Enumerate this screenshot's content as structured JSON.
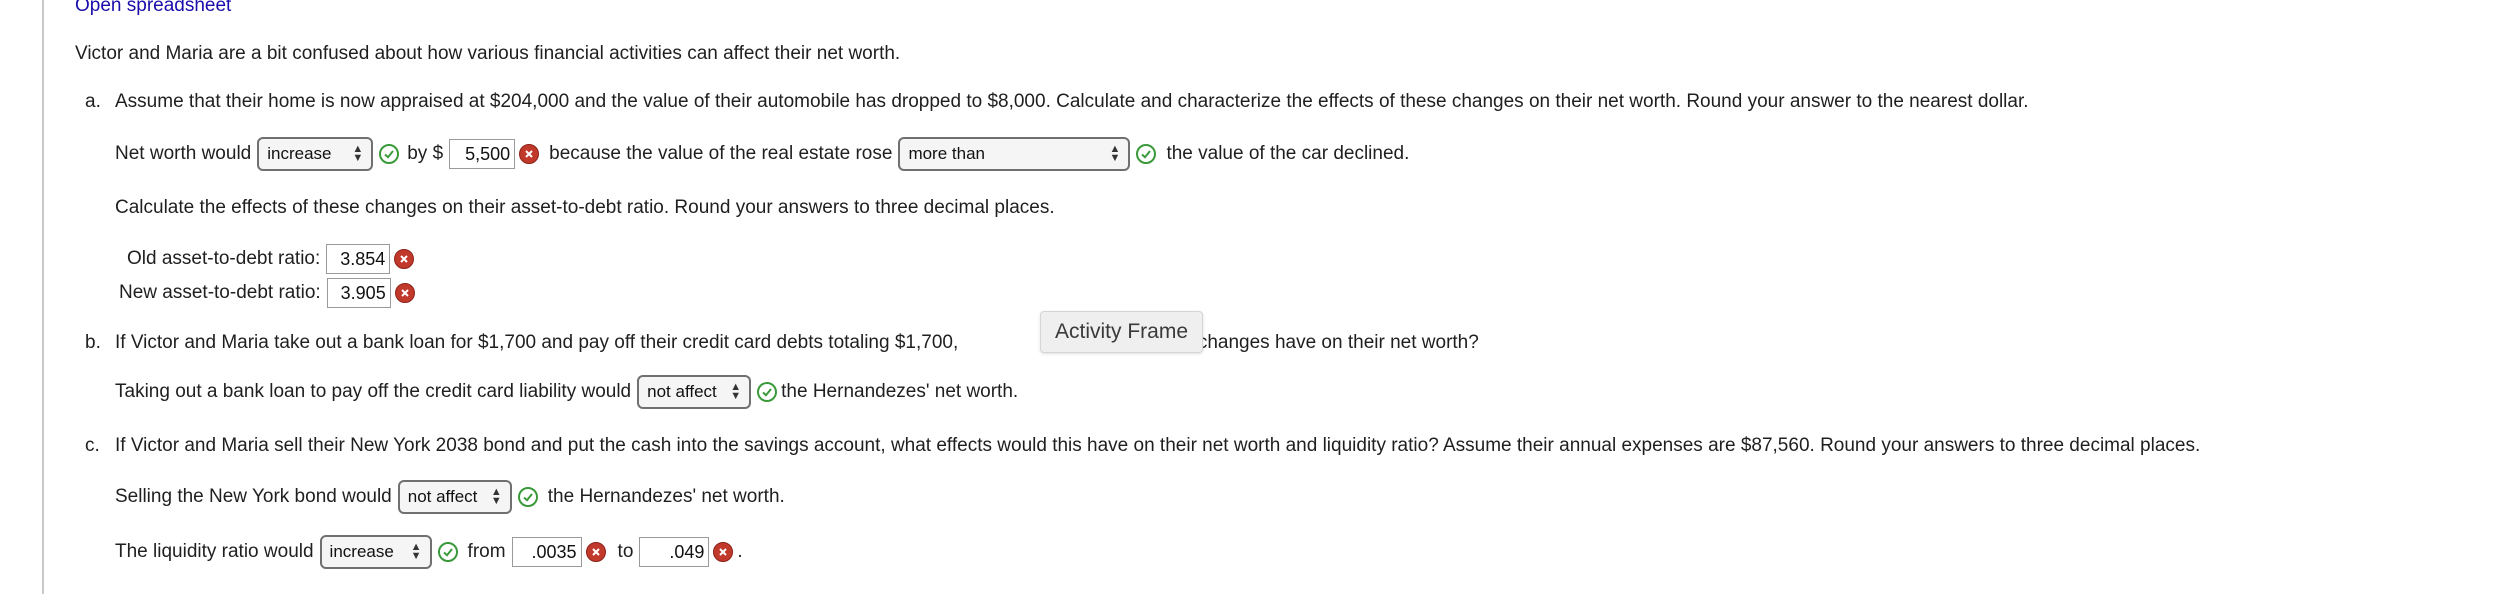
{
  "header": {
    "link": "Open spreadsheet"
  },
  "intro": "Victor and Maria are a bit confused about how various financial activities can affect their net worth.",
  "part_a": {
    "marker": "a.",
    "question": "Assume that their home is now appraised at $204,000 and the value of their automobile has dropped to $8,000. Calculate and characterize the effects of these changes on their net worth. Round your answer to the nearest dollar.",
    "line1": {
      "t1": "Net worth would",
      "select1": "increase",
      "t2": "by $",
      "amount": "5,500",
      "t3": "because the value of the real estate rose",
      "select2": "more than",
      "t4": "the value of the car declined."
    },
    "ratio_instruction": "Calculate the effects of these changes on their asset-to-debt ratio. Round your answers to three decimal places.",
    "old_label": "Old asset-to-debt ratio:",
    "old_value": "3.854",
    "new_label": "New asset-to-debt ratio:",
    "new_value": "3.905"
  },
  "part_b": {
    "marker": "b.",
    "question_start": "If Victor and Maria take out a bank loan for $1,700 and pay off their credit card debts totaling $1,700,",
    "question_end": "d these changes have on their net worth?",
    "t1": "Taking out a bank loan to pay off the credit card liability would",
    "select": "not affect",
    "t2": "the Hernandezes' net worth."
  },
  "part_c": {
    "marker": "c.",
    "question": "If Victor and Maria sell their New York 2038 bond and put the cash into the savings account, what effects would this have on their net worth and liquidity ratio? Assume their annual expenses are $87,560. Round your answers to three decimal places.",
    "line1": {
      "t1": "Selling the New York bond would",
      "select": "not affect",
      "t2": "the Hernandezes' net worth."
    },
    "line2": {
      "t1": "The liquidity ratio would",
      "select": "increase",
      "t2": "from",
      "from_value": ".0035",
      "t3": "to",
      "to_value": ".049",
      "t4": "."
    }
  },
  "tooltip": "Activity Frame",
  "icons": {
    "correct": "check-circle-icon",
    "incorrect": "x-circle-icon",
    "select_arrows": "updown-arrows-icon"
  },
  "colors": {
    "correct": "#3a9a3a",
    "incorrect": "#c0392b",
    "link": "#1a0dab"
  }
}
